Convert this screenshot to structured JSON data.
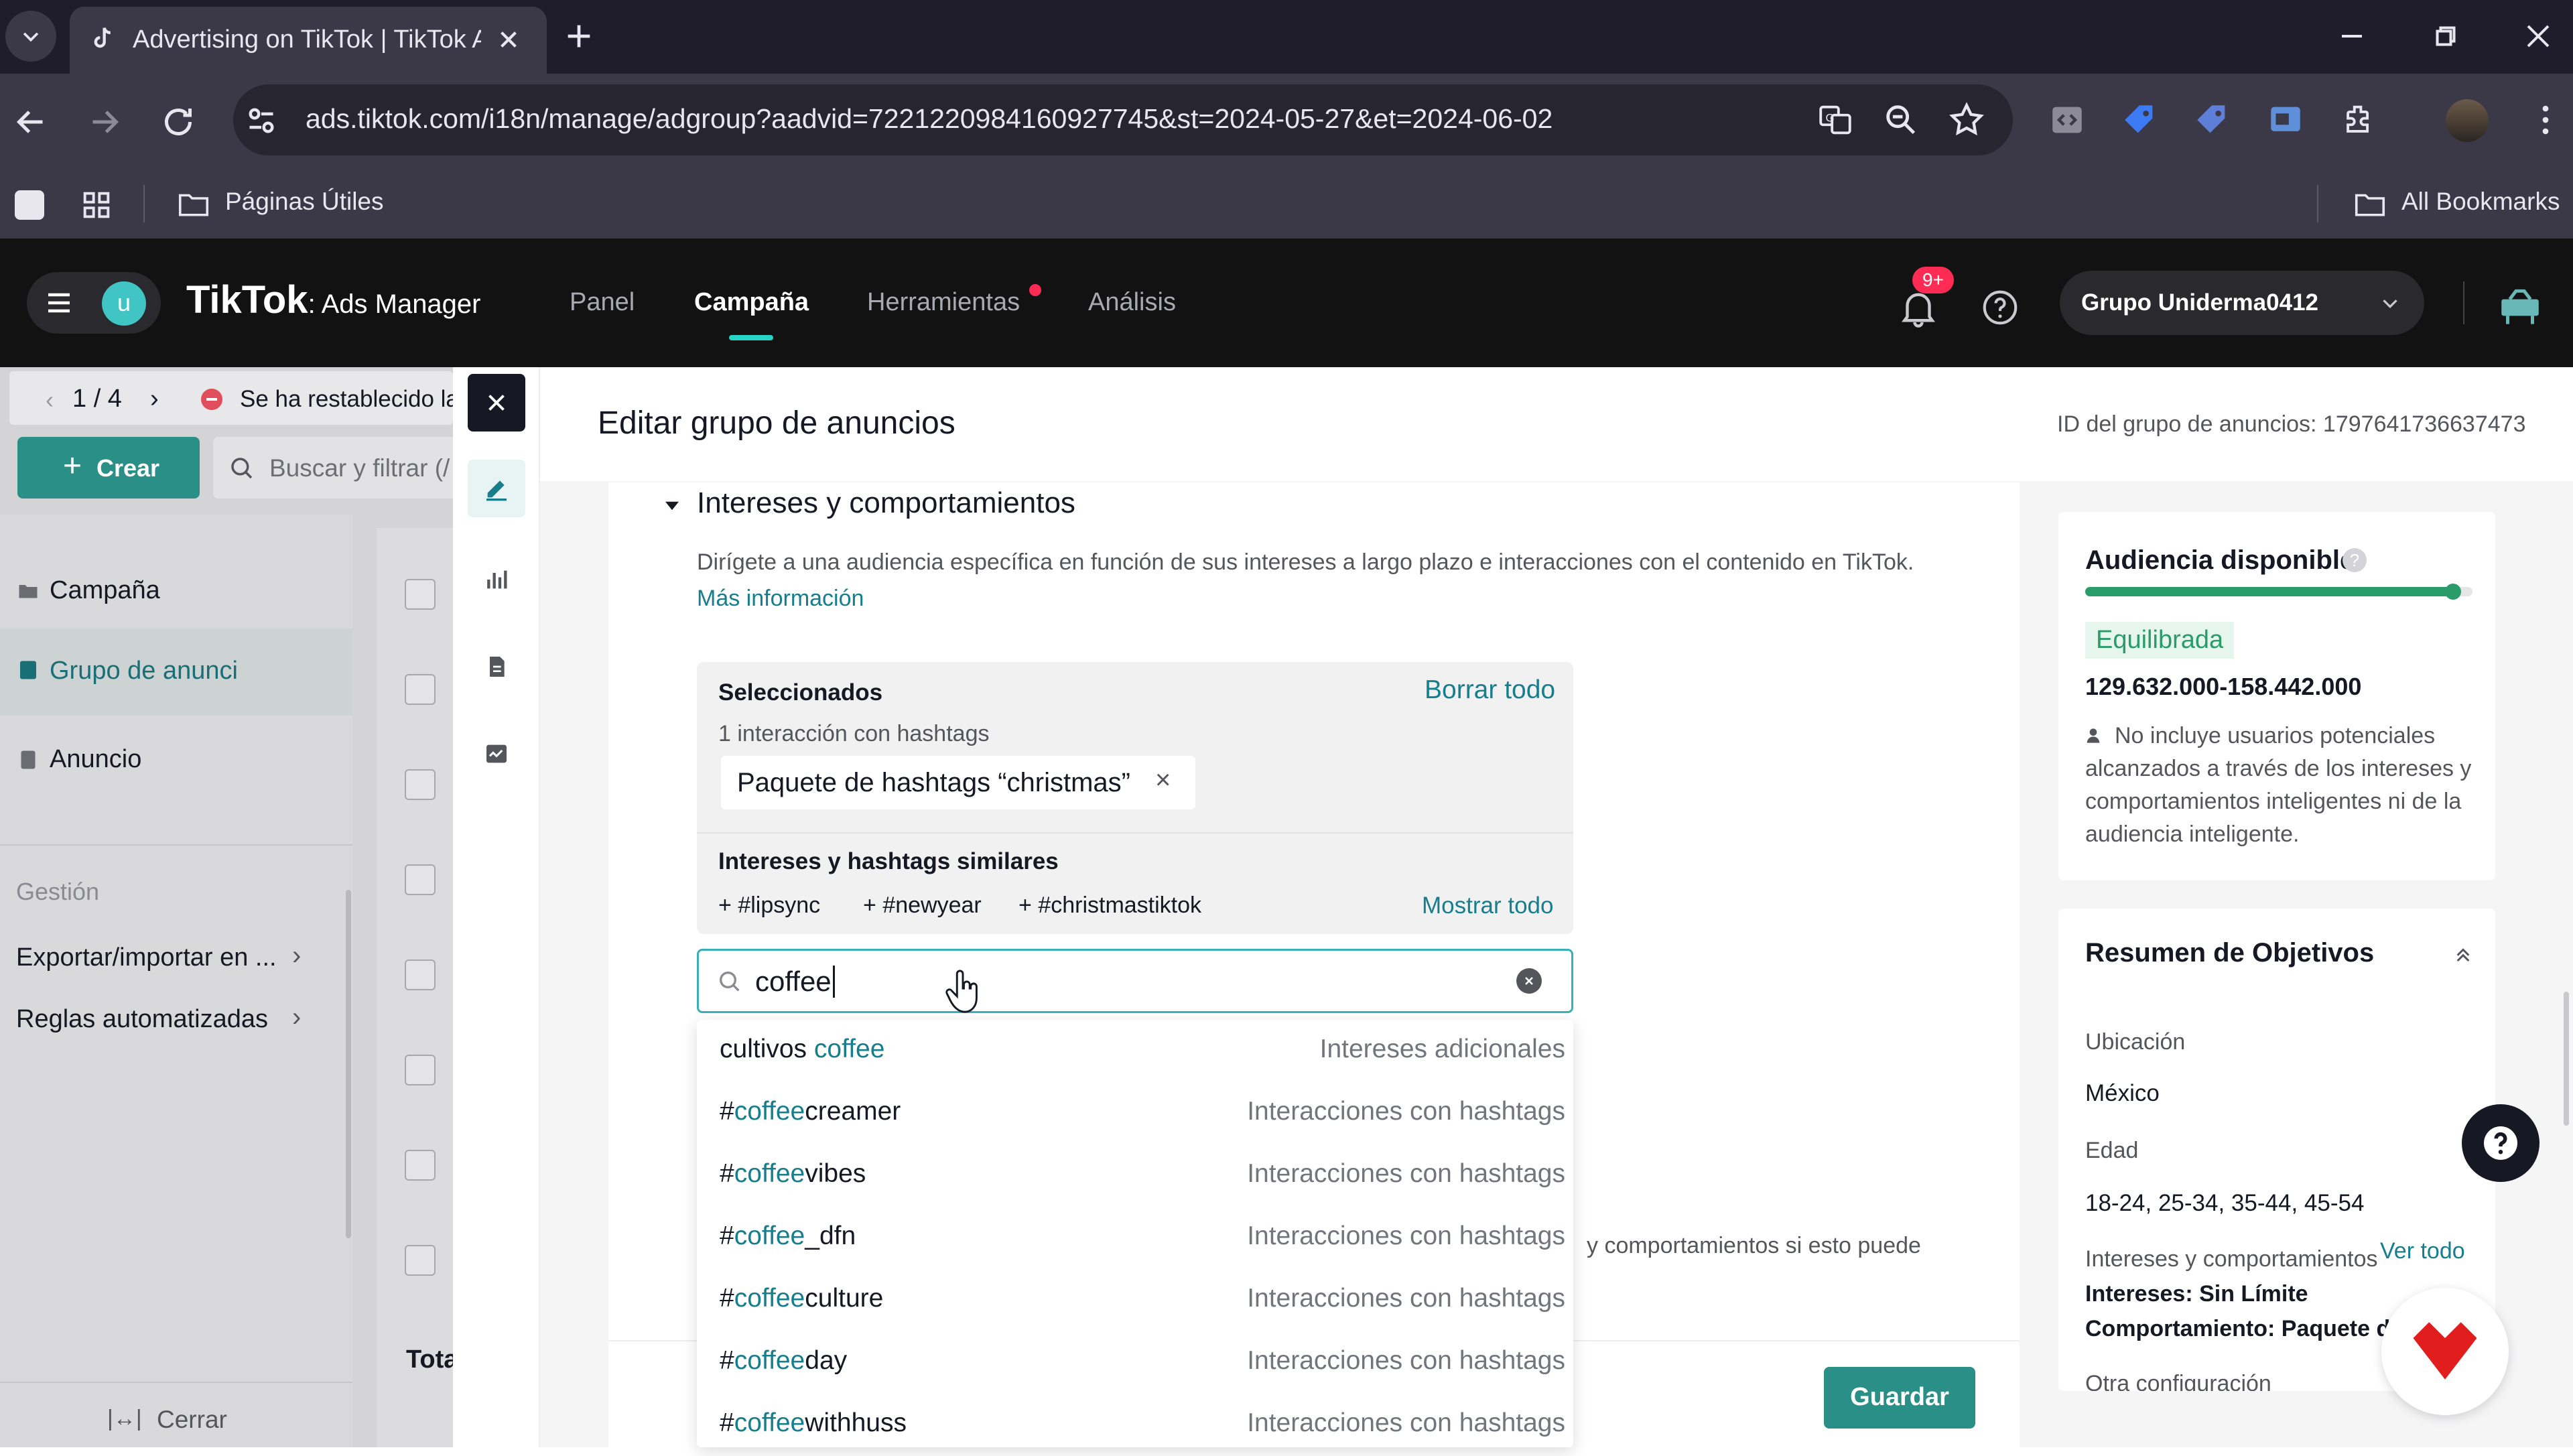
{
  "browser": {
    "tab_title": "Advertising on TikTok | TikTok A",
    "url": "ads.tiktok.com/i18n/manage/adgroup?aadvid=7221220984160927745&st=2024-05-27&et=2024-06-02",
    "bookmark_folder": "Páginas Útiles",
    "all_bookmarks": "All Bookmarks"
  },
  "header": {
    "logo": "TikTok",
    "logo_sub": ": Ads Manager",
    "avatar_letter": "u",
    "nav": [
      "Panel",
      "Campaña",
      "Herramientas",
      "Análisis"
    ],
    "notif_count": "9+",
    "account": "Grupo Uniderma0412"
  },
  "left": {
    "pager": "1 / 4",
    "restore_msg": "Se ha restablecido la",
    "create": "Crear",
    "search_placeholder": "Buscar y filtrar (/",
    "nav_items": [
      "Campaña",
      "Grupo de anunci",
      "Anuncio"
    ],
    "section": "Gestión",
    "links": [
      "Exportar/importar en ...",
      "Reglas automatizadas"
    ],
    "total": "Tota",
    "close": "Cerrar"
  },
  "panel": {
    "title": "Editar grupo de anuncios",
    "adgroup_id": "ID del grupo de anuncios: 1797641736637473",
    "section_title": "Intereses y comportamientos",
    "description": "Dirígete a una audiencia específica en función de sus intereses a largo plazo e interacciones con el contenido en TikTok.",
    "more_info": "Más información",
    "selected_label": "Seleccionados",
    "clear_all": "Borrar todo",
    "selected_count": "1 interacción con hashtags",
    "selected_tag": "Paquete de hashtags “christmas”",
    "similar_label": "Intereses y hashtags similares",
    "similar_tags": [
      "#lipsync",
      "#newyear",
      "#christmastiktok"
    ],
    "show_all": "Mostrar todo",
    "search_value": "coffee",
    "hidden_hint": "y comportamientos si esto puede",
    "save": "Guardar"
  },
  "dropdown": [
    {
      "pre": "cultivos ",
      "hl": "coffee",
      "post": "",
      "type": "Intereses adicionales"
    },
    {
      "pre": "#",
      "hl": "coffee",
      "post": "creamer",
      "type": "Interacciones con hashtags"
    },
    {
      "pre": "#",
      "hl": "coffee",
      "post": "vibes",
      "type": "Interacciones con hashtags"
    },
    {
      "pre": "#",
      "hl": "coffee",
      "post": "_dfn",
      "type": "Interacciones con hashtags"
    },
    {
      "pre": "#",
      "hl": "coffee",
      "post": "culture",
      "type": "Interacciones con hashtags"
    },
    {
      "pre": "#",
      "hl": "coffee",
      "post": "day",
      "type": "Interacciones con hashtags"
    },
    {
      "pre": "#",
      "hl": "coffee",
      "post": "withhuss",
      "type": "Interacciones con hashtags"
    }
  ],
  "audience": {
    "title": "Audiencia disponible",
    "level": 0.95,
    "status": "Equilibrada",
    "range": "129.632.000-158.442.000",
    "note": "No incluye usuarios potenciales alcanzados a través de los intereses y comportamientos inteligentes ni de la audiencia inteligente."
  },
  "summary": {
    "title": "Resumen de Objetivos",
    "location_label": "Ubicación",
    "location": "México",
    "age_label": "Edad",
    "age": "18-24, 25-34, 35-44, 45-54",
    "interests_label": "Intereses y comportamientos",
    "view_all": "Ver todo",
    "interests": "Intereses: Sin Límite",
    "behavior": "Comportamiento: Paquete de",
    "other": "Otra configuración"
  },
  "colors": {
    "accent": "#167e8c",
    "tiktok_red": "#fe2c55",
    "save_button": "#2a8f86",
    "create_button": "#2a8f86"
  }
}
